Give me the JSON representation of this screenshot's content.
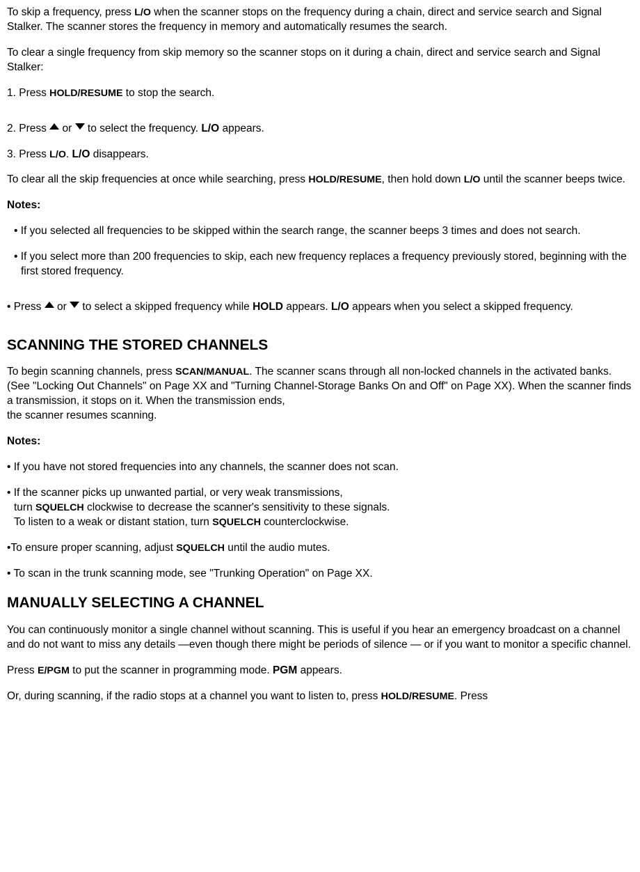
{
  "p1_a": "To skip a frequency, press ",
  "p1_key1": "L/O",
  "p1_b": " when the scanner stops on the frequency during a chain, direct and service search and Signal Stalker. The scanner stores the frequency in memory and automatically resumes the search.",
  "p2": "To clear a single frequency from skip memory so the scanner stops on it during a chain, direct and service search and Signal Stalker:",
  "s1_a": "1. Press ",
  "s1_key": "HOLD/RESUME",
  "s1_b": " to stop the search.",
  "s2_a": "2. Press  ",
  "s2_or": " or  ",
  "s2_b": " to select the frequency. ",
  "s2_key": "L/O",
  "s2_c": " appears.",
  "s3_a": "3. Press ",
  "s3_key": "L/O",
  "s3_b": ". ",
  "s3_key2": "L/O",
  "s3_c": " disappears.",
  "p3_a": "To clear all the skip frequencies at once while searching, press ",
  "p3_key1": "HOLD/RESUME",
  "p3_b": ", then hold down ",
  "p3_key2": "L/O",
  "p3_c": " until the scanner beeps twice.",
  "notes_label": "Notes:",
  "n1": "• If you selected all frequencies to be skipped within the search range, the scanner beeps 3 times and does not search.",
  "n2": "• If you select more than 200 frequencies to skip, each new frequency replaces a frequency previously stored, beginning with the first stored frequency.",
  "n3_a": "• Press  ",
  "n3_or": " or  ",
  "n3_b": " to select a skipped frequency while ",
  "n3_key1": "HOLD",
  "n3_c": " appears. ",
  "n3_key2": "L/O",
  "n3_d": " appears when you select a skipped frequency.",
  "h1": "SCANNING THE STORED CHANNELS",
  "p4_a": "To begin scanning channels, press ",
  "p4_key": "SCAN/MANUAL",
  "p4_b": ". The scanner scans through all non-locked channels in the activated banks. (See \"Locking Out Channels\" on Page XX and \"Turning Channel-Storage Banks On and Off\" on Page XX).    When the scanner finds a transmission, it stops on it. When the transmission ends,",
  "p4_c": "the scanner resumes scanning.",
  "sn1": "• If you have not stored frequencies into any channels, the scanner does not scan.",
  "sn2_a": "• If the scanner picks up unwanted partial, or very weak transmissions,",
  "sn2_b": "turn ",
  "sn2_key1": "SQUELCH",
  "sn2_c": " clockwise to decrease the scanner's sensitivity to these signals.",
  "sn2_d": "To listen to a weak or distant station, turn ",
  "sn2_key2": "SQUELCH",
  "sn2_e": " counterclockwise.",
  "sn3_a": "•To ensure proper scanning, adjust ",
  "sn3_key": "SQUELCH",
  "sn3_b": " until the audio mutes.",
  "sn4": "• To scan in the trunk scanning mode, see \"Trunking Operation\" on Page XX.",
  "h2": "MANUALLY SELECTING A CHANNEL",
  "p5": "You can continuously monitor a single channel without scanning. This is useful if you hear an emergency broadcast on a channel and do not want to miss any details —even though there might be periods of silence — or if you want to monitor a specific channel.",
  "p6_a": "Press ",
  "p6_key": "E/PGM",
  "p6_b": " to put the scanner in programming mode. ",
  "p6_key2": "PGM",
  "p6_c": " appears.",
  "p7_a": "Or, during scanning, if the radio stops at a channel you want to listen to, press ",
  "p7_key": "HOLD/RESUME",
  "p7_b": ". Press"
}
